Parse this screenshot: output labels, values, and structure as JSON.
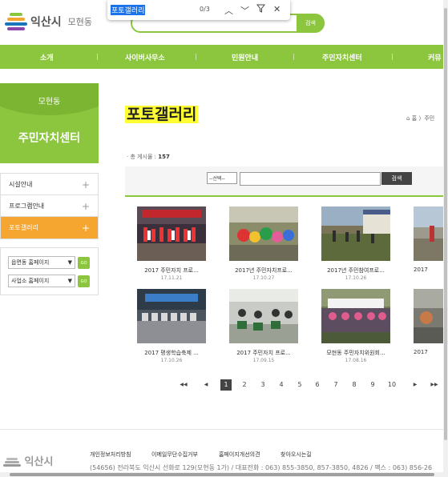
{
  "header": {
    "logo_text": "익산시",
    "logo_sub": "모현동",
    "search_button": "검색"
  },
  "findbar": {
    "query": "포토갤러리",
    "count": "0/3"
  },
  "nav": [
    "소개",
    "사이버사무소",
    "민원안내",
    "주민자치센터",
    "커뮤"
  ],
  "sidebar": {
    "dong": "모현동",
    "title": "주민자치센터",
    "items": [
      {
        "label": "시설안내",
        "active": false
      },
      {
        "label": "프로그램안내",
        "active": false
      },
      {
        "label": "포토갤러리",
        "active": true
      }
    ],
    "links": [
      {
        "label": "읍면동 홈페이지",
        "go": "GO"
      },
      {
        "label": "사업소 홈페이지",
        "go": "GO"
      }
    ]
  },
  "main": {
    "title": "포토갤러리",
    "breadcrumb": "홈 〉주민",
    "total_label": "· 총 게시물 : ",
    "total_count": "157",
    "search_select": "--선택--",
    "search_button": "검색"
  },
  "gallery": [
    {
      "caption": "2017 주민자치 프로...",
      "date": "17.11.21"
    },
    {
      "caption": "2017년 주민자치프로...",
      "date": "17.10.27"
    },
    {
      "caption": "2017년 주민참여프로...",
      "date": "17.10.26"
    },
    {
      "caption": "2017",
      "date": ""
    },
    {
      "caption": "2017 평생학습축제 ...",
      "date": "17.10.26"
    },
    {
      "caption": "2017 주민자치 프로...",
      "date": "17.09.15"
    },
    {
      "caption": "모현동 주민자치위원회...",
      "date": "17.08.16"
    },
    {
      "caption": "2017",
      "date": ""
    }
  ],
  "pager": {
    "first": "◀◀",
    "prev": "◀",
    "pages": [
      "1",
      "2",
      "3",
      "4",
      "5",
      "6",
      "7",
      "8",
      "9",
      "10"
    ],
    "current": "1",
    "next": "▶",
    "last": "▶▶"
  },
  "footer": {
    "links": [
      "개인정보처리방침",
      "이메일무단수집거부",
      "홈페이지개선의견",
      "찾아오시는길"
    ],
    "address": "(54656) 전라북도 익산시 선화로 129(모현동 1가) / 대표전화 : 063) 855-3850, 857-3850, 4826 / 팩스 : 063) 856-26",
    "logo": "익산시"
  }
}
